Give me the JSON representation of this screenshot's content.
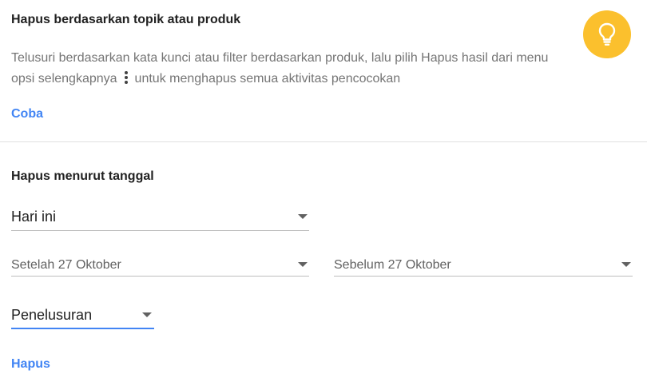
{
  "topic_section": {
    "title": "Hapus berdasarkan topik atau produk",
    "description_part1": "Telusuri berdasarkan kata kunci atau filter berdasarkan produk, lalu pilih Hapus hasil dari menu opsi selengkapnya",
    "description_part2": "untuk menghapus semua aktivitas pencocokan",
    "try_link": "Coba",
    "icon": "lightbulb-icon",
    "icon_color": "#fbc02d"
  },
  "date_section": {
    "title": "Hapus menurut tanggal",
    "range_select": "Hari ini",
    "after_select": "Setelah 27 Oktober",
    "before_select": "Sebelum 27 Oktober",
    "product_select": "Penelusuran",
    "delete_link": "Hapus"
  },
  "colors": {
    "accent": "#4285f4",
    "title_text": "#212121",
    "secondary_text": "#757575"
  }
}
